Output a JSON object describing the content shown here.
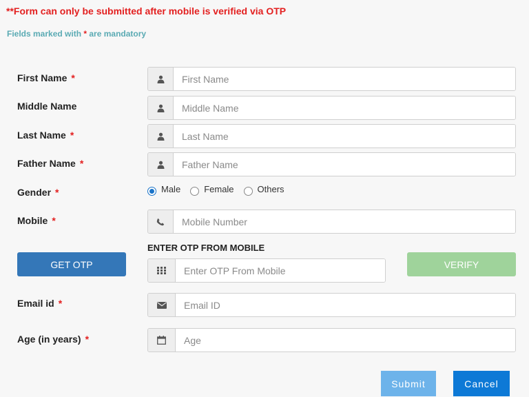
{
  "notice": "**Form can only be submitted after mobile is verified via OTP",
  "mandatory_note": {
    "prefix": "Fields marked with ",
    "star": "*",
    "suffix": " are mandatory"
  },
  "required_marker": "*",
  "fields": {
    "first_name": {
      "label": "First Name",
      "placeholder": "First Name",
      "icon": "user-icon"
    },
    "middle_name": {
      "label": "Middle Name",
      "placeholder": "Middle Name",
      "icon": "user-icon"
    },
    "last_name": {
      "label": "Last Name",
      "placeholder": "Last Name",
      "icon": "user-icon"
    },
    "father_name": {
      "label": "Father Name",
      "placeholder": "Father Name",
      "icon": "user-icon"
    },
    "gender": {
      "label": "Gender",
      "options": [
        "Male",
        "Female",
        "Others"
      ],
      "selected": "Male"
    },
    "mobile": {
      "label": "Mobile",
      "placeholder": "Mobile Number",
      "icon": "phone-icon"
    },
    "otp": {
      "heading": "ENTER OTP FROM MOBILE",
      "placeholder": "Enter OTP From Mobile",
      "icon": "keypad-icon"
    },
    "email": {
      "label": "Email id",
      "placeholder": "Email ID",
      "icon": "envelope-icon"
    },
    "age": {
      "label": "Age (in years)",
      "placeholder": "Age",
      "icon": "calendar-icon"
    }
  },
  "buttons": {
    "get_otp": "GET OTP",
    "verify": "VERIFY",
    "submit": "Submit",
    "cancel": "Cancel"
  },
  "colors": {
    "notice": "#e32020",
    "mandatory_note": "#5aaab3",
    "get_otp": "#3477b8",
    "verify": "#9fd39b",
    "submit": "#6db3ea",
    "cancel": "#0d79d6"
  }
}
